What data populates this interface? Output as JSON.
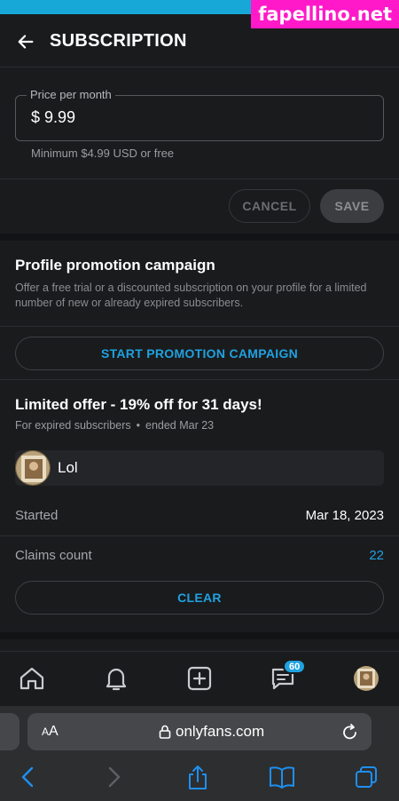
{
  "watermark": "fapellino.net",
  "header": {
    "title": "SUBSCRIPTION"
  },
  "price": {
    "label": "Price per month",
    "currency": "$",
    "value": "9.99",
    "hint": "Minimum $4.99 USD or free"
  },
  "actions": {
    "cancel": "CANCEL",
    "save": "SAVE"
  },
  "promo": {
    "title": "Profile promotion campaign",
    "description": "Offer a free trial or a discounted subscription on your profile for a limited number of new or already expired subscribers.",
    "button": "START PROMOTION CAMPAIGN"
  },
  "offer": {
    "title": "Limited offer - 19% off for 31 days!",
    "audience": "For expired subscribers",
    "dot": "•",
    "ended": "ended Mar 23",
    "message": "Lol",
    "started_label": "Started",
    "started_value": "Mar 18, 2023",
    "claims_label": "Claims count",
    "claims_value": "22",
    "clear": "CLEAR"
  },
  "tabbar": {
    "notifications_badge": "60",
    "icons": [
      "home-icon",
      "bell-icon",
      "add-post-icon",
      "messages-icon",
      "profile-avatar"
    ]
  },
  "browser": {
    "aa_small": "A",
    "aa_large": "A",
    "url": "onlyfans.com"
  },
  "colors": {
    "accent": "#1fa2e0",
    "background": "#1a1b1d",
    "watermark": "#ff19c8",
    "topbar": "#18a8d8"
  }
}
